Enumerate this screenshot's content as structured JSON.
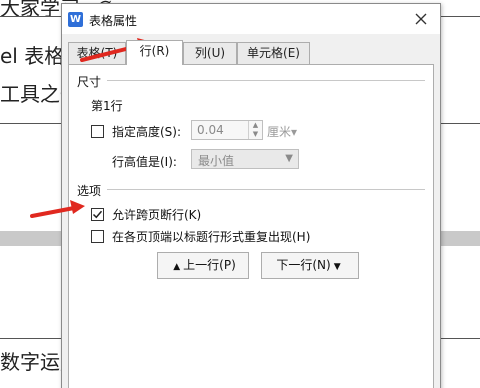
{
  "background_doc": {
    "lines": [
      "大家学习≥∅",
      "el 表格",
      "工具之一",
      "数字运用"
    ]
  },
  "dialog": {
    "title": "表格属性",
    "tabs": [
      {
        "label": "表格(T)",
        "active": false
      },
      {
        "label": "行(R)",
        "active": true
      },
      {
        "label": "列(U)",
        "active": false
      },
      {
        "label": "单元格(E)",
        "active": false
      }
    ],
    "size_section": {
      "title": "尺寸",
      "row_label": "第1行",
      "specify_height_label": "指定高度(S):",
      "specify_height_checked": false,
      "height_value": "0.04",
      "height_unit": "厘米▾",
      "row_height_is_label": "行高值是(I):",
      "row_height_is_value": "最小值"
    },
    "options_section": {
      "title": "选项",
      "allow_break_label": "允许跨页断行(K)",
      "allow_break_checked": true,
      "repeat_header_label": "在各页顶端以标题行形式重复出现(H)",
      "repeat_header_checked": false
    },
    "buttons": {
      "prev_row": "上一行(P)",
      "next_row": "下一行(N)"
    }
  },
  "colors": {
    "annotation_arrow": "#e0281f",
    "app_icon": "#2f6fd8"
  }
}
